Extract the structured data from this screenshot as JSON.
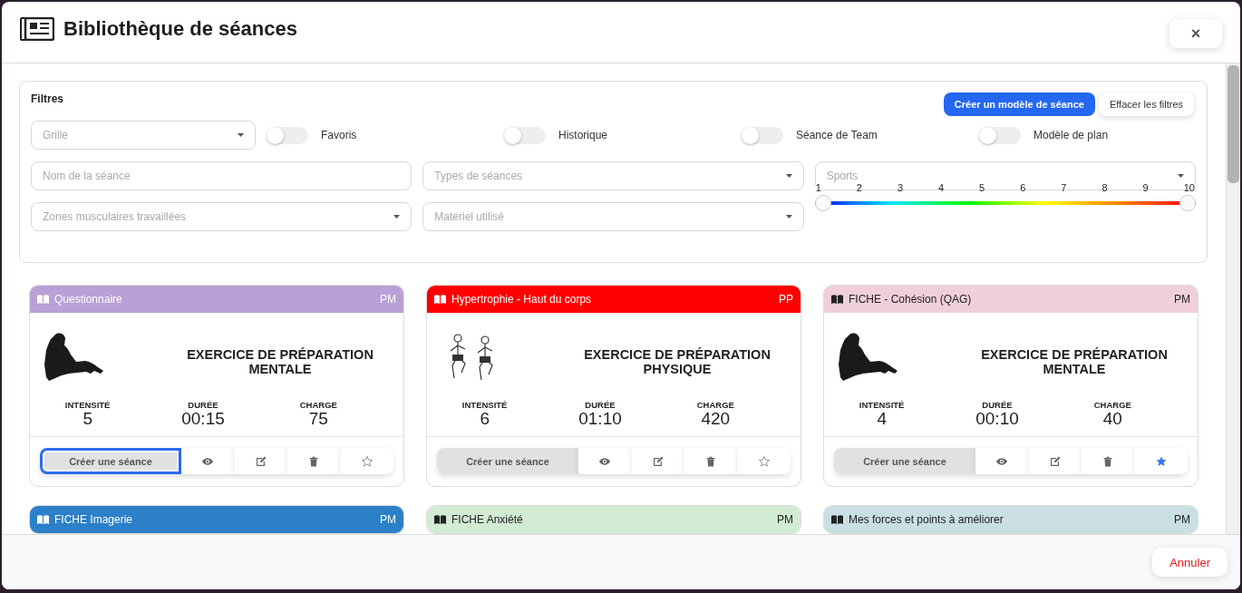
{
  "window": {
    "title": "Bibliothèque de séances",
    "close_label": "×"
  },
  "filters": {
    "title": "Filtres",
    "buttons": [
      {
        "label": "Créer un modèle de séance",
        "kind": "primary"
      },
      {
        "label": "Effacer les filtres",
        "kind": "secondary"
      }
    ],
    "grid_select": {
      "placeholder": "Grille"
    },
    "toggles": [
      {
        "label": "Favoris",
        "on": false
      },
      {
        "label": "Historique",
        "on": false
      },
      {
        "label": "Séance de Team",
        "on": false
      },
      {
        "label": "Modèle de plan",
        "on": false
      }
    ],
    "fields": [
      {
        "placeholder": "Nom de la séance",
        "kind": "text"
      },
      {
        "placeholder": "Types de séances",
        "kind": "select"
      },
      {
        "placeholder": "Sports",
        "kind": "select"
      },
      {
        "placeholder": "Zones musculaires travaillées",
        "kind": "select"
      },
      {
        "placeholder": "Matériel utilisé",
        "kind": "select"
      }
    ],
    "intensity_slider": {
      "ticks": [
        "1",
        "2",
        "3",
        "4",
        "5",
        "6",
        "7",
        "8",
        "9",
        "10"
      ],
      "thumbs": [
        {
          "level": 0
        },
        {
          "level": 1
        }
      ]
    }
  },
  "cards": [
    {
      "title": "Questionnaire",
      "code": "PM",
      "color": "#b9a0d6",
      "kind": "seated",
      "category": "EXERCICE DE PRÉPARATION MENTALE",
      "stats": [
        {
          "label": "INTENSITÉ",
          "value": "5"
        },
        {
          "label": "DURÉE",
          "value": "00:15"
        },
        {
          "label": "CHARGE",
          "value": "75"
        }
      ],
      "create_label": "Créer une séance",
      "focused": true,
      "favorite": false
    },
    {
      "title": "Hypertrophie - Haut du corps",
      "code": "PP",
      "color": "#fe0000",
      "kind": "running",
      "category": "EXERCICE DE PRÉPARATION PHYSIQUE",
      "stats": [
        {
          "label": "INTENSITÉ",
          "value": "6"
        },
        {
          "label": "DURÉE",
          "value": "01:10"
        },
        {
          "label": "CHARGE",
          "value": "420"
        }
      ],
      "create_label": "Créer une séance",
      "focused": false,
      "favorite": false
    },
    {
      "title": "FICHE - Cohésion (QAG)",
      "code": "PM",
      "color": "#f0cfdb",
      "kind": "seated",
      "category": "EXERCICE DE PRÉPARATION MENTALE",
      "stats": [
        {
          "label": "INTENSITÉ",
          "value": "4"
        },
        {
          "label": "DURÉE",
          "value": "00:10"
        },
        {
          "label": "CHARGE",
          "value": "40"
        }
      ],
      "create_label": "Créer une séance",
      "focused": false,
      "favorite": true
    },
    {
      "title": "FICHE Imagerie",
      "code": "PM",
      "color": "#2b80c8"
    },
    {
      "title": "FICHE Anxiété",
      "code": "PM",
      "color": "#d2ebd3"
    },
    {
      "title": "Mes forces et points à améliorer",
      "code": "PM",
      "color": "#c9dfe3"
    }
  ],
  "footer": {
    "cancel_label": "Annuler"
  }
}
